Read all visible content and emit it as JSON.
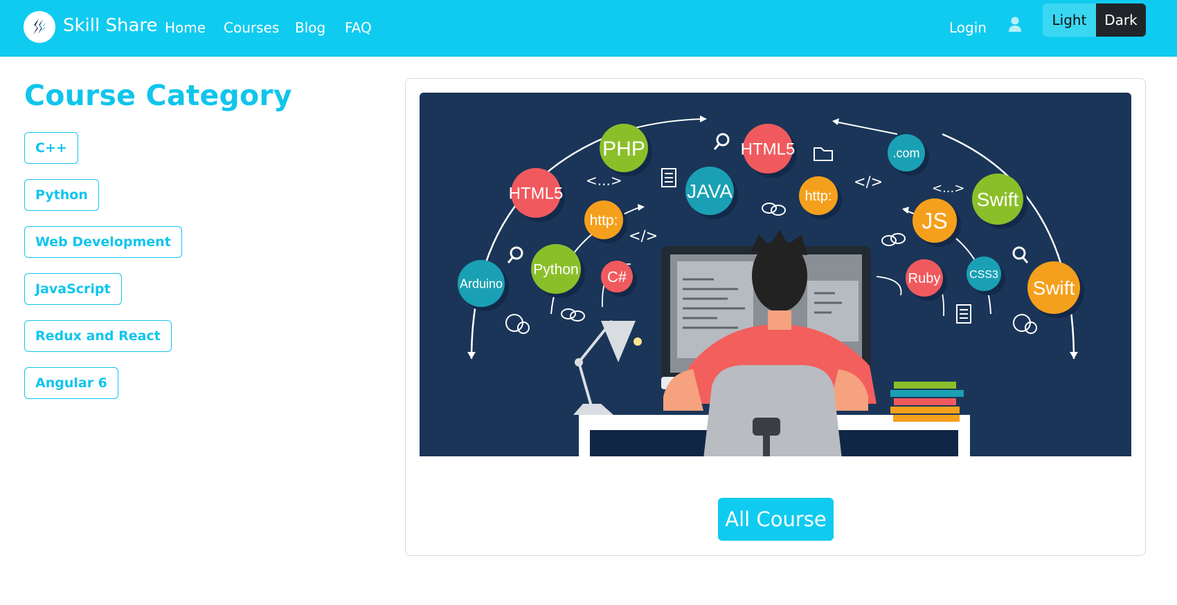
{
  "brand": {
    "name": "Skill Share",
    "logo_icon": "skillshare-s-icon"
  },
  "nav": {
    "links": [
      {
        "label": "Home"
      },
      {
        "label": "Courses"
      },
      {
        "label": "Blog"
      },
      {
        "label": "FAQ"
      }
    ],
    "login_label": "Login",
    "user_icon": "user-icon"
  },
  "theme": {
    "light_label": "Light",
    "dark_label": "Dark"
  },
  "sidebar": {
    "title": "Course Category",
    "categories": [
      {
        "label": "C++"
      },
      {
        "label": "Python"
      },
      {
        "label": "Web Development"
      },
      {
        "label": "JavaScript"
      },
      {
        "label": "Redux and React"
      },
      {
        "label": "Angular 6"
      }
    ]
  },
  "hero": {
    "bubbles": [
      {
        "label": "PHP",
        "color": "#8bbf2a"
      },
      {
        "label": "HTML5",
        "color": "#f05a5e"
      },
      {
        "label": "JAVA",
        "color": "#1aa0b4"
      },
      {
        "label": ".com",
        "color": "#1aa0b4"
      },
      {
        "label": "HTML5",
        "color": "#f05a5e"
      },
      {
        "label": "http:",
        "color": "#f5a01c"
      },
      {
        "label": "Swift",
        "color": "#8bbf2a"
      },
      {
        "label": "http:",
        "color": "#f5a01c"
      },
      {
        "label": "JS",
        "color": "#f5a01c"
      },
      {
        "label": "Arduino",
        "color": "#1aa0b4"
      },
      {
        "label": "Python",
        "color": "#8bbf2a"
      },
      {
        "label": "C#",
        "color": "#f05a5e"
      },
      {
        "label": "Ruby",
        "color": "#f05a5e"
      },
      {
        "label": "CSS3",
        "color": "#1aa0b4"
      },
      {
        "label": "Swift",
        "color": "#f5a01c"
      }
    ],
    "code_tags": [
      "<...>",
      "</>",
      "</>",
      "<...>"
    ]
  },
  "card": {
    "button_label": "All Course"
  },
  "colors": {
    "brand": "#10cbf0",
    "dark": "#212529",
    "hero_bg": "#1a3558"
  }
}
